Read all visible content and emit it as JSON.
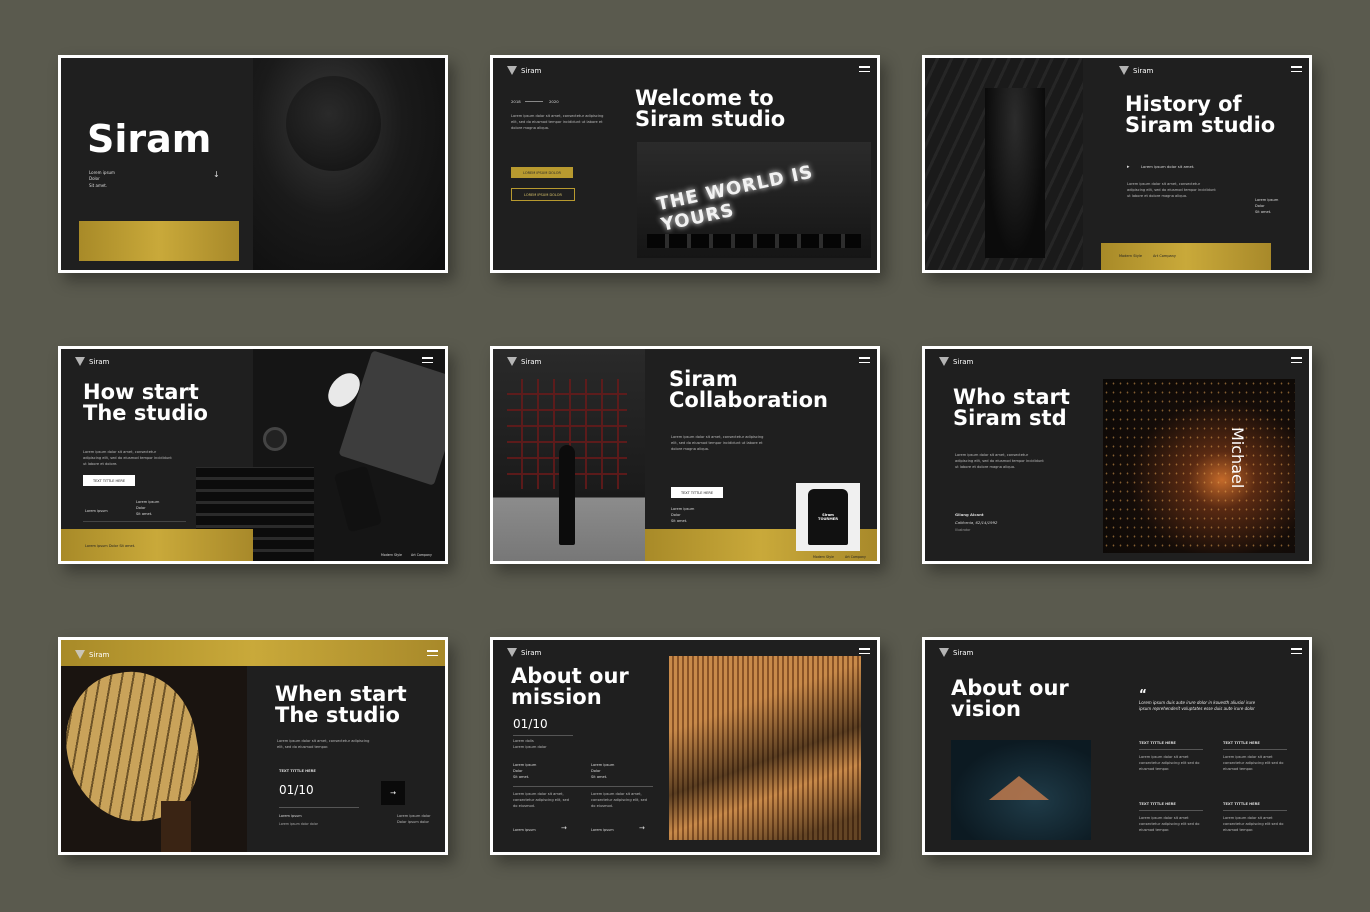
{
  "slides": {
    "s1": {
      "title": "Siram",
      "text": "Lorem ipsum\nDolor\nSit amet."
    },
    "s2": {
      "brand": "Siram",
      "title": "Welcome to\nSiram studio",
      "year_start": "2018",
      "year_end": "2020",
      "text": "Lorem ipsum dolor sit amet, consectetur adipiscing elit, sed do eiusmod tempor incididunt ut labore et dolore magna aliqua.",
      "button1": "LOREM IPSUM DOLOR",
      "button2": "LOREM IPSUM DOLOR",
      "neon": "THE WORLD IS YOURS"
    },
    "s3": {
      "brand": "Siram",
      "title": "History of\nSiram studio",
      "bullet": "Lorem ipsum dolor sit amet.",
      "text": "Lorem ipsum dolor sit amet, consectetur adipiscing elit, sed do eiusmod tempor incididunt ut labore et dolore magna aliqua.",
      "side": "Lorem ipsum\nDolor\nSit amet.",
      "footer1": "Modern Style",
      "footer2": "Art Company"
    },
    "s4": {
      "brand": "Siram",
      "title": "How start\nThe studio",
      "text": "Lorem ipsum dolor sit amet, consectetur adipiscing elit, sed do eiusmod tempor incididunt ut labore et dolore.",
      "button": "TEXT TITTLE HERE",
      "label": "Lorem ipsum",
      "side": "Lorem ipsum\nDolor\nSit amet.",
      "gold_text": "Lorem ipsum Dolor Sit amet.",
      "footer1": "Modern Style",
      "footer2": "Art Company"
    },
    "s5": {
      "brand": "Siram",
      "title": "Siram\nCollaboration",
      "text": "Lorem ipsum dolor sit amet, consectetur adipiscing elit, sed do eiusmod tempor incididunt ut labore et dolore magna aliqua.",
      "button": "TEXT TITTLE HERE",
      "side": "Lorem ipsum\nDolor\nSit amet.",
      "shirt": "Siram TOURMER",
      "footer1": "Modern Style",
      "footer2": "Art Company"
    },
    "s6": {
      "brand": "Siram",
      "title": "Who start\nSiram std",
      "text": "Lorem ipsum dolor sit amet, consectetur adipiscing elit, sed do eiusmod tempor incididunt ut labore et dolore magna aliqua.",
      "name": "Gilang Alcant",
      "location": "California, 62/14/1992",
      "role": "Illustrator",
      "vertical": "Michael"
    },
    "s7": {
      "brand": "Siram",
      "title": "When start\nThe studio",
      "text": "Lorem ipsum dolor sit amet, consectetur adipiscing elit, sed do eiusmod tempor.",
      "label": "TEXT TITTLE HERE",
      "counter": "01/10",
      "bottom1": "Lorem ipsum",
      "bottom2": "Lorem ipsum dolor dolor",
      "right": "Lorem ipsum dolor\nDolor ipsum dolor"
    },
    "s8": {
      "brand": "Siram",
      "title": "About our\nmission",
      "counter": "01/10",
      "sub": "Lorem dolis\nLorem ipsum dolor",
      "col1": "Lorem ipsum\nDolor\nSit amet.",
      "col2": "Lorem ipsum\nDolor\nSit amet.",
      "text": "Lorem ipsum dolor sit amet, consectetur adipiscing elit, sed do eiusmod.",
      "link1": "Lorem ipsum",
      "link2": "Lorem ipsum"
    },
    "s9": {
      "brand": "Siram",
      "title": "About our\nvision",
      "quote_mark": "“",
      "quote": "Lorem ipsum duis aute irure dolor in kouesth aliusiol irure\nipsum reprehenderit voluptates esse duis aute irure dolor",
      "h1": "TEXT TITTLE HERE",
      "h2": "TEXT TITTLE HERE",
      "h3": "TEXT TITTLE HERE",
      "h4": "TEXT TITTLE HERE",
      "body": "Lorem ipsum dolor sit amet consectetur adipiscing elit sed do eiusmod tempor."
    }
  },
  "colors": {
    "bg": "#5a5a4e",
    "slide": "#1f1f1f",
    "gold": "#b89a2f"
  }
}
